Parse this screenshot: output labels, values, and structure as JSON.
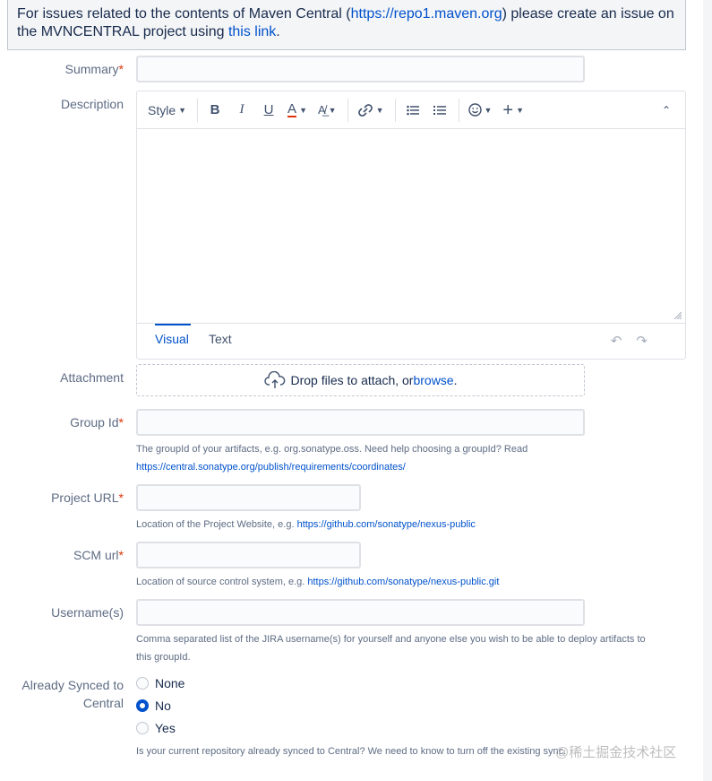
{
  "notice": {
    "prefix": "For issues related to the contents of Maven Central (",
    "repo_link": "https://repo1.maven.org",
    "middle": ") please create an issue on the MVNCENTRAL project using ",
    "this_link": "this link",
    "suffix": "."
  },
  "fields": {
    "summary_label": "Summary",
    "description_label": "Description",
    "attachment_label": "Attachment",
    "group_id_label": "Group Id",
    "project_url_label": "Project URL",
    "scm_url_label": "SCM url",
    "usernames_label": "Username(s)",
    "synced_label_line1": "Already Synced to",
    "synced_label_line2": "Central",
    "required_mark": "*"
  },
  "editor": {
    "style_label": "Style",
    "tabs": [
      {
        "label": "Visual",
        "active": true
      },
      {
        "label": "Text",
        "active": false
      }
    ],
    "toolbar_icons": [
      "bold-icon",
      "italic-icon",
      "underline-icon",
      "text-color-icon",
      "text-format-icon",
      "link-icon",
      "bullet-list-icon",
      "numbered-list-icon",
      "emoji-icon",
      "insert-more-icon",
      "collapse-toolbar-icon"
    ]
  },
  "attachment": {
    "text": "Drop files to attach, or ",
    "browse": "browse",
    "suffix": "."
  },
  "help": {
    "group_id_line1": "The groupId of your artifacts, e.g. org.sonatype.oss. Need help choosing a groupId? Read",
    "group_id_link": "https://central.sonatype.org/publish/requirements/coordinates/",
    "project_url_text": "Location of the Project Website, e.g. ",
    "project_url_link": "https://github.com/sonatype/nexus-public",
    "scm_text": "Location of source control system, e.g. ",
    "scm_link": "https://github.com/sonatype/nexus-public.git",
    "usernames_line1": "Comma separated list of the JIRA username(s) for yourself and anyone else you wish to be able to deploy artifacts to",
    "usernames_line2": "this groupId.",
    "synced_text": "Is your current repository already synced to Central? We need to know to turn off the existing sync."
  },
  "synced_options": [
    {
      "label": "None",
      "checked": false
    },
    {
      "label": "No",
      "checked": true
    },
    {
      "label": "Yes",
      "checked": false
    }
  ],
  "watermark": "@稀土掘金技术社区",
  "colors": {
    "link": "#0052cc",
    "required": "#de350b",
    "label": "#5e6c84",
    "radio_checked": "#0052cc"
  }
}
